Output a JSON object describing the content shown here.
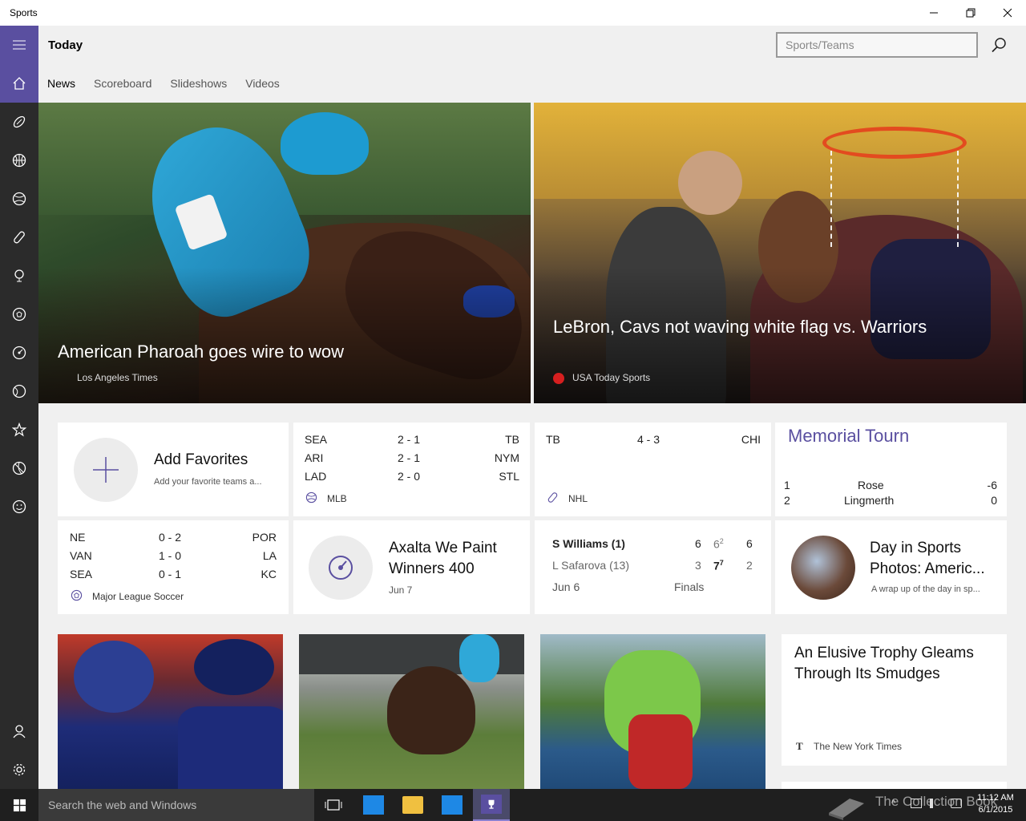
{
  "window": {
    "title": "Sports"
  },
  "header": {
    "title": "Today",
    "search_placeholder": "Sports/Teams"
  },
  "tabs": [
    {
      "label": "News",
      "active": true
    },
    {
      "label": "Scoreboard",
      "active": false
    },
    {
      "label": "Slideshows",
      "active": false
    },
    {
      "label": "Videos",
      "active": false
    }
  ],
  "rail_icons": [
    "home-icon",
    "football-icon",
    "basketball-icon",
    "baseball-icon",
    "hockey-icon",
    "golf-icon",
    "soccer-icon",
    "motorsports-icon",
    "tennis-icon",
    "star-icon",
    "rugby-icon",
    "smiley-icon",
    "person-icon",
    "gear-icon"
  ],
  "hero": [
    {
      "headline": "American Pharoah goes wire to wow",
      "source": "Los Angeles Times"
    },
    {
      "headline": "LeBron, Cavs not waving white flag vs. Warriors",
      "source": "USA Today Sports"
    }
  ],
  "favorites": {
    "title": "Add Favorites",
    "subtitle": "Add your favorite teams a..."
  },
  "mlb": {
    "league": "MLB",
    "games": [
      {
        "home": "SEA",
        "score": "2 - 1",
        "away": "TB"
      },
      {
        "home": "ARI",
        "score": "2 - 1",
        "away": "NYM"
      },
      {
        "home": "LAD",
        "score": "2 - 0",
        "away": "STL"
      }
    ]
  },
  "nhl": {
    "league": "NHL",
    "games": [
      {
        "home": "TB",
        "score": "4 - 3",
        "away": "CHI"
      }
    ]
  },
  "golf": {
    "title": "Memorial Tourn",
    "leaders": [
      {
        "pos": "1",
        "name": "Rose",
        "score": "-6"
      },
      {
        "pos": "2",
        "name": "Lingmerth",
        "score": "0"
      }
    ]
  },
  "mls": {
    "league": "Major League Soccer",
    "games": [
      {
        "home": "NE",
        "score": "0 - 2",
        "away": "POR"
      },
      {
        "home": "VAN",
        "score": "1 - 0",
        "away": "LA"
      },
      {
        "home": "SEA",
        "score": "0 - 1",
        "away": "KC"
      }
    ]
  },
  "nascar": {
    "title_line1": "Axalta We Paint",
    "title_line2": "Winners 400",
    "date": "Jun 7"
  },
  "tennis": {
    "player1": {
      "name": "S Williams (1)",
      "s1": "6",
      "s2": "6",
      "s2_sup": "2",
      "s3": "6"
    },
    "player2": {
      "name": "L Safarova (13)",
      "s1": "3",
      "s2": "7",
      "s2_sup": "7",
      "s3": "2"
    },
    "date": "Jun 6",
    "round": "Finals"
  },
  "photos": {
    "title_line1": "Day in Sports",
    "title_line2": "Photos: Americ...",
    "subtitle": "A wrap up of the day in sp..."
  },
  "article": {
    "title_line1": "An Elusive Trophy Gleams",
    "title_line2": "Through Its Smudges",
    "source": "The New York Times",
    "source_icon": "T"
  },
  "taskbar": {
    "search_placeholder": "Search the web and Windows",
    "watermark": "The Collection Book",
    "time": "11:12 AM",
    "date": "6/1/2015"
  },
  "colors": {
    "accent": "#5a4fa0",
    "rail": "#2b2b2b",
    "taskbar": "#1f1f1f"
  }
}
